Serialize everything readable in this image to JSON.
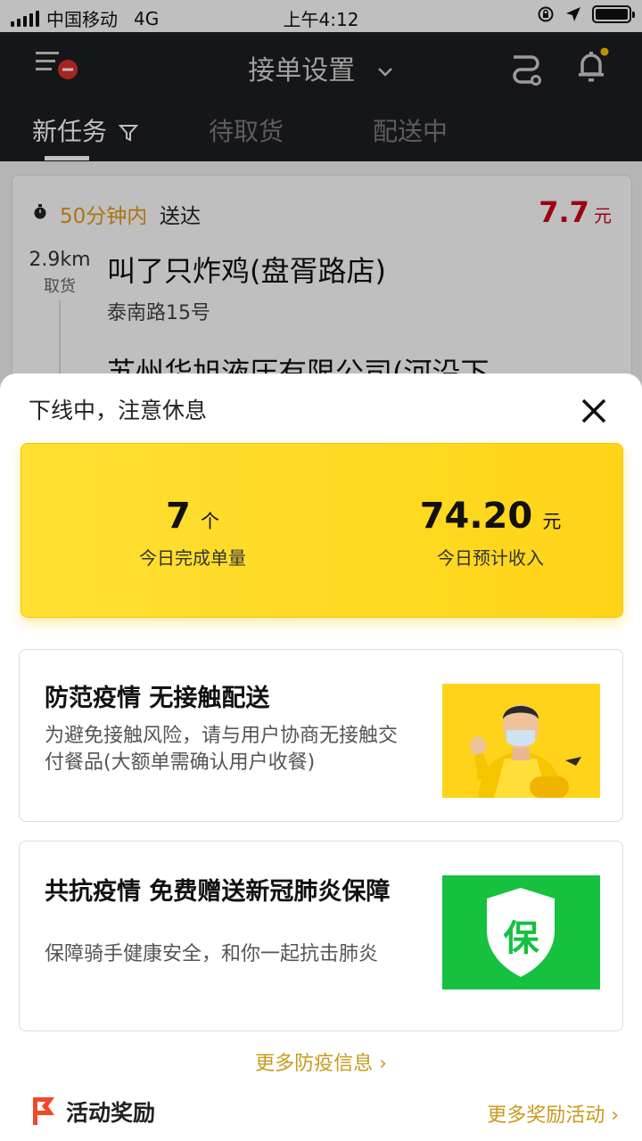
{
  "status_bar": {
    "carrier": "中国移动",
    "network": "4G",
    "time": "上午4:12"
  },
  "header": {
    "title": "接单设置",
    "tabs": [
      {
        "label": "新任务",
        "active": true
      },
      {
        "label": "待取货",
        "active": false
      },
      {
        "label": "配送中",
        "active": false
      }
    ]
  },
  "task": {
    "deliver_time": "50分钟内",
    "deliver_suffix": "送达",
    "price": "7.7",
    "price_unit": "元",
    "distance": "2.9km",
    "distance_label": "取货",
    "shop_name": "叫了只炸鸡(盘胥路店)",
    "shop_address": "泰南路15号",
    "destination_name": "苏州华旭液压有限公司(河沿下"
  },
  "sheet": {
    "title": "下线中，注意休息",
    "stats": [
      {
        "value": "7",
        "unit": "个",
        "label": "今日完成单量"
      },
      {
        "value": "74.20",
        "unit": "元",
        "label": "今日预计收入"
      }
    ],
    "cards": [
      {
        "title": "防范疫情 无接触配送",
        "desc": "为避免接触风险，请与用户协商无接触交付餐品(大额单需确认用户收餐)",
        "image": "rider-with-mask"
      },
      {
        "title": "共抗疫情 免费赠送新冠肺炎保障",
        "desc": "保障骑手健康安全，和你一起抗击肺炎",
        "image": "insurance-shield",
        "badge_text": "保"
      }
    ],
    "more_info_link": "更多防疫信息 ›",
    "activity_title": "活动奖励",
    "activity_link": "更多奖励活动 ›"
  },
  "colors": {
    "header_bg": "#1d1e22",
    "accent_yellow": "#ffd418",
    "price_red": "#d0021b",
    "link_gold": "#c89a1c",
    "shield_green": "#15c13f"
  }
}
